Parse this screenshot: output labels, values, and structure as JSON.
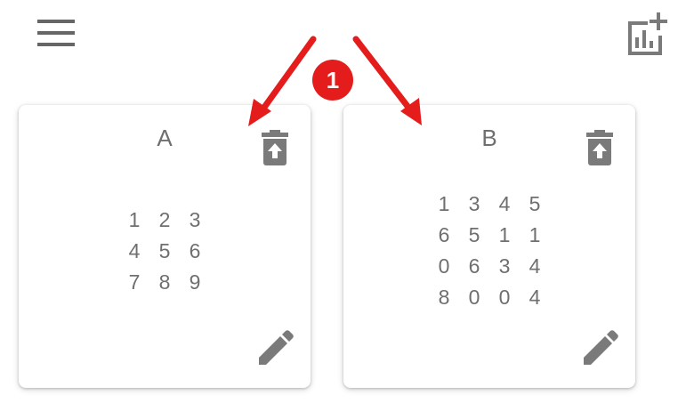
{
  "header": {
    "menu_icon": "hamburger-menu-icon",
    "add_chart_icon": "add-chart-icon"
  },
  "cards": [
    {
      "title": "A",
      "matrix": [
        [
          "1",
          "2",
          "3"
        ],
        [
          "4",
          "5",
          "6"
        ],
        [
          "7",
          "8",
          "9"
        ]
      ],
      "delete_icon": "delete-icon",
      "edit_icon": "pencil-icon"
    },
    {
      "title": "B",
      "matrix": [
        [
          "1",
          "3",
          "4",
          "5"
        ],
        [
          "6",
          "5",
          "1",
          "1"
        ],
        [
          "0",
          "6",
          "3",
          "4"
        ],
        [
          "8",
          "0",
          "0",
          "4"
        ]
      ],
      "delete_icon": "delete-icon",
      "edit_icon": "pencil-icon"
    }
  ],
  "annotation": {
    "badge": "1",
    "color": "#e51c1c"
  },
  "colors": {
    "icon": "#7a7a7a",
    "text": "#6f6f6f",
    "card_background": "#ffffff"
  }
}
